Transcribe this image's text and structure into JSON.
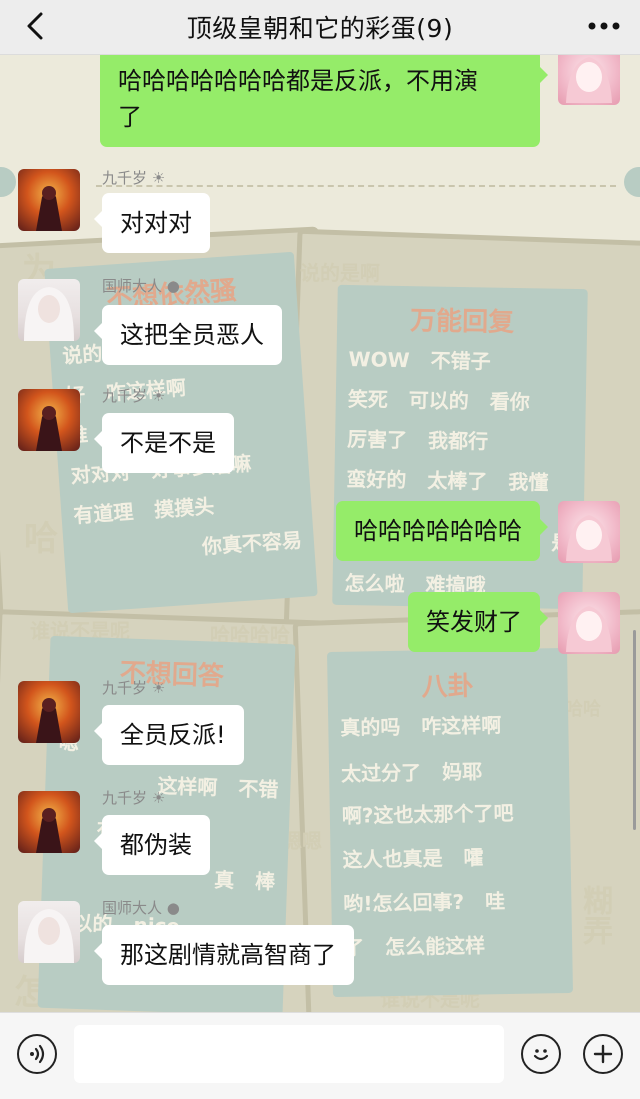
{
  "header": {
    "title": "顶级皇朝和它的彩蛋(9)",
    "back_icon": "chevron-left-icon",
    "more_icon": "more-dots-icon"
  },
  "wallpaper": {
    "panel_left_top": {
      "title": "不想依然骚",
      "lines": [
        "说的是啊 难为你了",
        "好 咋这样啊",
        "谁 哪",
        "对对对 好事多磨嘛",
        "有道理 摸摸头",
        "你真不容易"
      ]
    },
    "panel_right_top": {
      "title": "万能回复",
      "lines": [
        "WOW 不错子",
        "笑死 可以的 看你",
        "厉害了 我都行",
        "蛮好的 太棒了 我懂",
        "是",
        "怎么啦 难搞哦"
      ]
    },
    "panel_left_bottom": {
      "title": "不想回答",
      "lines": [
        "嗯",
        "这样啊 不错",
        "有 有道理",
        "真 棒",
        "可以的 nice"
      ]
    },
    "panel_right_bottom": {
      "title": "八卦",
      "lines": [
        "真的吗 咋这样啊",
        "太过分了 妈耶",
        "啊?这也太那个了吧",
        "这人也真是 嚯",
        "哟!怎么回事? 哇",
        "了 怎么能这样"
      ]
    },
    "scattered": [
      "说的是啊",
      "谁说不是呢",
      "哈哈哈哈",
      "嗯嗯",
      "糊弄",
      "哈",
      "哈哈",
      "谁说不是呢",
      "为",
      "怎么"
    ]
  },
  "messages": [
    {
      "side": "out",
      "text_lines": [
        "哈哈哈哈哈哈哈都是反派，不用演",
        "了"
      ]
    },
    {
      "side": "in",
      "sender": "九千岁 ☀",
      "text": "对对对"
    },
    {
      "side": "in",
      "sender": "国师大人 ●",
      "text": "这把全员恶人"
    },
    {
      "side": "in",
      "sender": "九千岁 ☀",
      "text": "不是不是"
    },
    {
      "side": "out",
      "text": "哈哈哈哈哈哈哈"
    },
    {
      "side": "out",
      "text": "笑发财了"
    },
    {
      "side": "in",
      "sender": "九千岁 ☀",
      "text": "全员反派!"
    },
    {
      "side": "in",
      "sender": "九千岁 ☀",
      "text": "都伪装"
    },
    {
      "side": "in",
      "sender": "国师大人 ●",
      "text": "那这剧情就高智商了"
    }
  ],
  "inputbar": {
    "voice_icon": "voice-icon",
    "input_value": "",
    "emoji_icon": "emoji-icon",
    "plus_icon": "plus-icon"
  }
}
